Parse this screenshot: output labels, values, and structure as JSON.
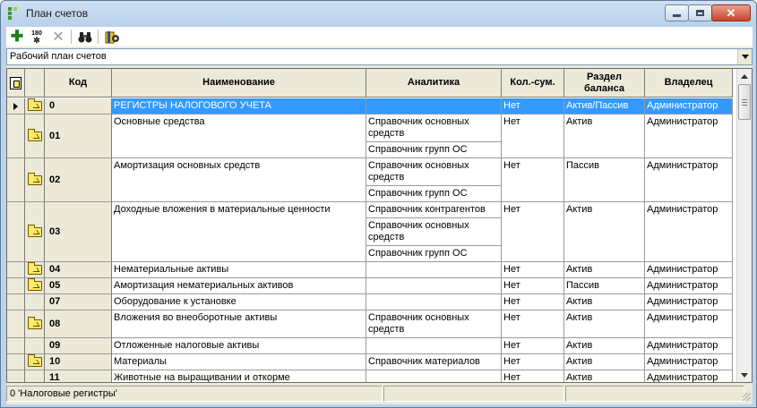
{
  "window": {
    "title": "План счетов"
  },
  "toolbar": {
    "add_icon": "plus-icon",
    "number_icon": "numbering-icon",
    "number_label_top": "180",
    "delete_icon": "delete-icon",
    "find_icon": "binoculars-icon",
    "settings_icon": "book-settings-icon"
  },
  "plan_select": {
    "value": "Рабочий план счетов"
  },
  "grid": {
    "columns": {
      "code": "Код",
      "name": "Наименование",
      "analytics": "Аналитика",
      "qty": "Кол.-сум.",
      "section": "Раздел баланса",
      "owner": "Владелец"
    },
    "rows": [
      {
        "code": "0",
        "name": "РЕГИСТРЫ НАЛОГОВОГО УЧЕТА",
        "analytics": [
          ""
        ],
        "qty": "Нет",
        "section": "Актив/Пассив",
        "owner": "Администратор",
        "folder": true,
        "selected": true
      },
      {
        "code": "01",
        "name": "Основные средства",
        "analytics": [
          "Справочник основных средств",
          "Справочник групп ОС"
        ],
        "qty": "Нет",
        "section": "Актив",
        "owner": "Администратор",
        "folder": true
      },
      {
        "code": "02",
        "name": "Амортизация основных средств",
        "analytics": [
          "Справочник основных средств",
          "Справочник групп ОС"
        ],
        "qty": "Нет",
        "section": "Пассив",
        "owner": "Администратор",
        "folder": true
      },
      {
        "code": "03",
        "name": "Доходные вложения в материальные ценности",
        "analytics": [
          "Справочник контрагентов",
          "Справочник основных средств",
          "Справочник групп ОС"
        ],
        "qty": "Нет",
        "section": "Актив",
        "owner": "Администратор",
        "folder": true
      },
      {
        "code": "04",
        "name": "Нематериальные активы",
        "analytics": [
          ""
        ],
        "qty": "Нет",
        "section": "Актив",
        "owner": "Администратор",
        "folder": true
      },
      {
        "code": "05",
        "name": "Амортизация нематериальных активов",
        "analytics": [
          ""
        ],
        "qty": "Нет",
        "section": "Пассив",
        "owner": "Администратор",
        "folder": true
      },
      {
        "code": "07",
        "name": "Оборудование к установке",
        "analytics": [
          ""
        ],
        "qty": "Нет",
        "section": "Актив",
        "owner": "Администратор",
        "folder": false
      },
      {
        "code": "08",
        "name": "Вложения во внеоборотные активы",
        "analytics": [
          "Справочник основных средств"
        ],
        "qty": "Нет",
        "section": "Актив",
        "owner": "Администратор",
        "folder": true
      },
      {
        "code": "09",
        "name": "Отложенные налоговые активы",
        "analytics": [
          ""
        ],
        "qty": "Нет",
        "section": "Актив",
        "owner": "Администратор",
        "folder": false
      },
      {
        "code": "10",
        "name": "Материалы",
        "analytics": [
          "Справочник материалов"
        ],
        "qty": "Нет",
        "section": "Актив",
        "owner": "Администратор",
        "folder": true
      },
      {
        "code": "11",
        "name": "Животные на выращивании и откорме",
        "analytics": [
          ""
        ],
        "qty": "Нет",
        "section": "Актив",
        "owner": "Администратор",
        "folder": false
      }
    ]
  },
  "status": {
    "text": "0 'Налоговые регистры'"
  }
}
